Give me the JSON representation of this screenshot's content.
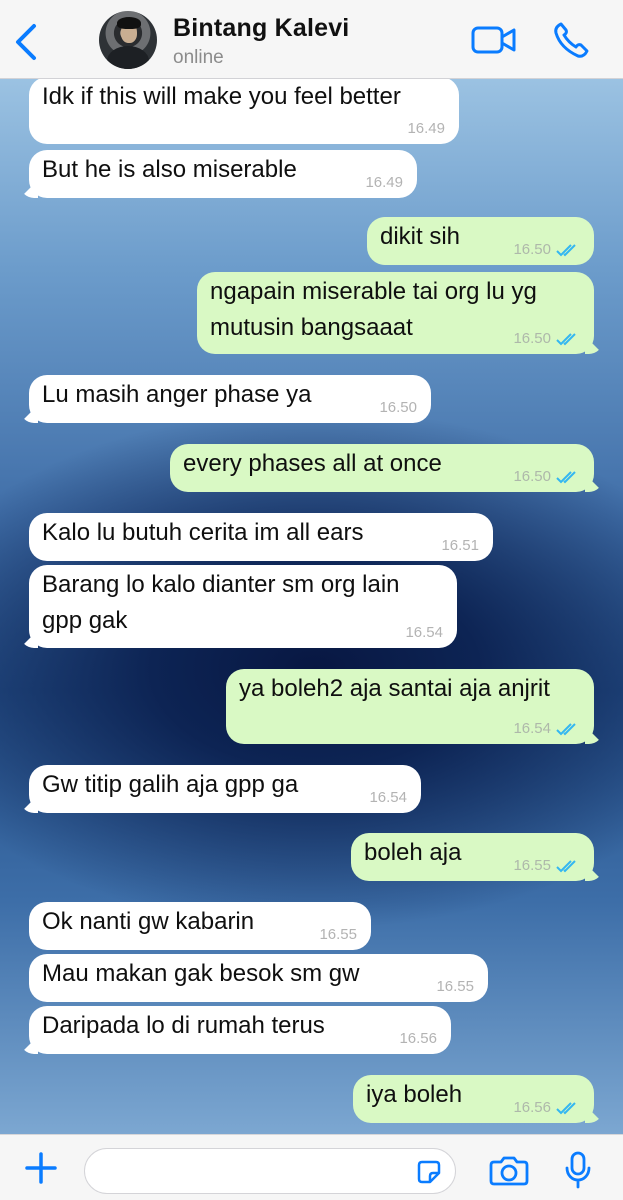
{
  "header": {
    "contact_name": "Bintang Kalevi",
    "status": "online",
    "back_icon": "chevron-left-icon",
    "video_icon": "video-camera-icon",
    "call_icon": "phone-icon",
    "accent_color": "#0a7cff"
  },
  "messages": [
    {
      "id": "m1",
      "direction": "in",
      "text": "Idk if this will make you feel better",
      "time": "16.49",
      "tail": false
    },
    {
      "id": "m2",
      "direction": "in",
      "text": "But he is also miserable",
      "time": "16.49",
      "tail": true
    },
    {
      "id": "m3",
      "direction": "out",
      "text": "dikit sih",
      "time": "16.50",
      "read": true,
      "tail": false
    },
    {
      "id": "m4",
      "direction": "out",
      "text": "ngapain miserable tai org lu yg mutusin bangsaaat",
      "time": "16.50",
      "read": true,
      "tail": true
    },
    {
      "id": "m5",
      "direction": "in",
      "text": "Lu masih anger phase ya",
      "time": "16.50",
      "tail": true
    },
    {
      "id": "m6",
      "direction": "out",
      "text": "every phases all at once",
      "time": "16.50",
      "read": true,
      "tail": true
    },
    {
      "id": "m7",
      "direction": "in",
      "text": "Kalo lu butuh cerita im all ears",
      "time": "16.51",
      "tail": false
    },
    {
      "id": "m8",
      "direction": "in",
      "text": "Barang lo kalo dianter sm org lain gpp gak",
      "time": "16.54",
      "tail": true
    },
    {
      "id": "m9",
      "direction": "out",
      "text": "ya boleh2 aja santai aja anjrit",
      "time": "16.54",
      "read": true,
      "tail": true
    },
    {
      "id": "m10",
      "direction": "in",
      "text": "Gw titip galih aja gpp ga",
      "time": "16.54",
      "tail": true
    },
    {
      "id": "m11",
      "direction": "out",
      "text": "boleh aja",
      "time": "16.55",
      "read": true,
      "tail": true
    },
    {
      "id": "m12",
      "direction": "in",
      "text": "Ok nanti gw kabarin",
      "time": "16.55",
      "tail": false
    },
    {
      "id": "m13",
      "direction": "in",
      "text": "Mau makan gak besok sm gw",
      "time": "16.55",
      "tail": false
    },
    {
      "id": "m14",
      "direction": "in",
      "text": "Daripada lo di rumah terus",
      "time": "16.56",
      "tail": true
    },
    {
      "id": "m15",
      "direction": "out",
      "text": "iya boleh",
      "time": "16.56",
      "read": true,
      "tail": true
    }
  ],
  "composer": {
    "placeholder": "",
    "plus_icon": "plus-icon",
    "sticker_icon": "sticker-icon",
    "camera_icon": "camera-icon",
    "mic_icon": "microphone-icon"
  },
  "colors": {
    "incoming_bubble": "#ffffff",
    "outgoing_bubble": "#d9f9c4",
    "read_ticks": "#34b7f1"
  }
}
